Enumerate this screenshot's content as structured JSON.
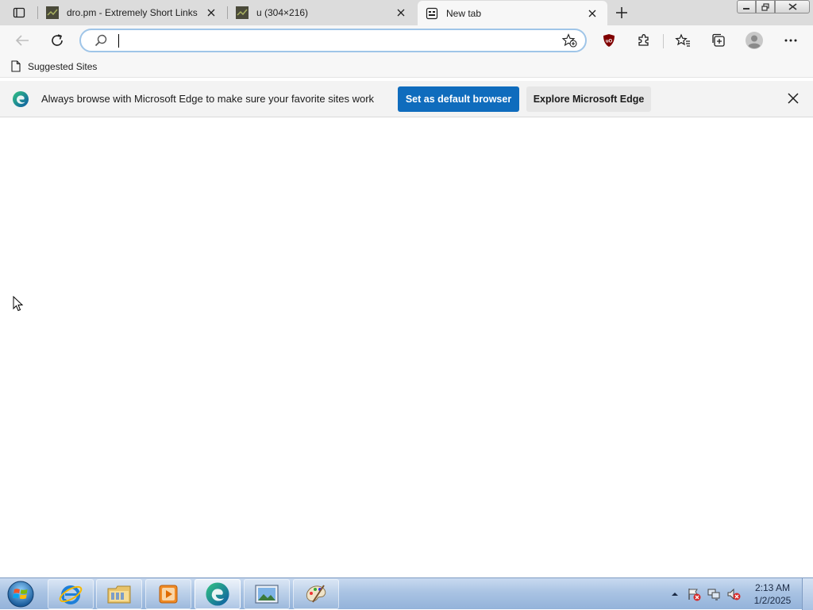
{
  "browser": {
    "tabs": [
      {
        "title": "dro.pm - Extremely Short Links",
        "active": false,
        "favicon": "dro-pm-favicon"
      },
      {
        "title": "u (304×216)",
        "active": false,
        "favicon": "image-favicon"
      },
      {
        "title": "New tab",
        "active": true,
        "favicon": "new-tab-icon"
      }
    ],
    "address_bar": {
      "value": "",
      "placeholder": ""
    },
    "favorites": [
      {
        "label": "Suggested Sites",
        "icon": "page-icon"
      }
    ]
  },
  "infobar": {
    "message": "Always browse with Microsoft Edge to make sure your favorite sites work",
    "primary_button": "Set as default browser",
    "secondary_button": "Explore Microsoft Edge"
  },
  "taskbar": {
    "apps": [
      {
        "name": "internet-explorer"
      },
      {
        "name": "file-explorer"
      },
      {
        "name": "media-player"
      },
      {
        "name": "microsoft-edge",
        "active": true
      },
      {
        "name": "photo-viewer"
      },
      {
        "name": "paint"
      }
    ],
    "clock": {
      "time": "2:13 AM",
      "date": "1/2/2025"
    }
  },
  "colors": {
    "accent": "#0f6cbd",
    "tabstrip": "#dcdcdc",
    "ublock": "#800000"
  }
}
